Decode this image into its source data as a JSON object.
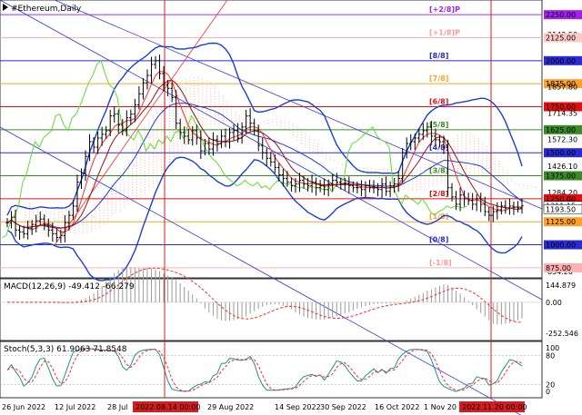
{
  "window": {
    "title": "#Ethereum,Daily"
  },
  "colors": {
    "bg": "#ffffff",
    "ohlc": "#000000",
    "bollinger": "#1a3fd6",
    "envelope": "#ff2a2a",
    "chikou": "#5fdc2f",
    "kumo": "#f0b9a8",
    "channel": "#3a3ad6",
    "macd_signal": "#ff2a2a",
    "macd_hist": "#9a9a9a",
    "stoch_main": "#1f8f8f",
    "stoch_signal": "#ff2a2a",
    "vline": "#d21e1e"
  },
  "murrey_levels": [
    {
      "label": "[+2/8]P",
      "price": 2250.0,
      "line": "#9b30ff",
      "text": "#a020f0"
    },
    {
      "label": "[+1/8]P",
      "price": 2125.0,
      "line": "#ffb0b0",
      "text": "#ff9a9a"
    },
    {
      "label": "[8/8]",
      "price": 2000.0,
      "line": "#2a2ad6",
      "text": "#2a2ad6"
    },
    {
      "label": "[7/8]",
      "price": 1875.0,
      "line": "#ffa126",
      "text": "#ffa126"
    },
    {
      "label": "[6/8]",
      "price": 1750.0,
      "line": "#e11010",
      "text": "#e11010"
    },
    {
      "label": "[5/8]",
      "price": 1625.0,
      "line": "#3a8a2a",
      "text": "#3a8a2a"
    },
    {
      "label": "[4/8]",
      "price": 1500.0,
      "line": "#2a2ad6",
      "text": "#2a2ad6"
    },
    {
      "label": "[3/8]",
      "price": 1375.0,
      "line": "#3a8a2a",
      "text": "#3a8a2a"
    },
    {
      "label": "[2/8]",
      "price": 1250.0,
      "line": "#e11010",
      "text": "#e11010"
    },
    {
      "label": "[1/8]",
      "price": 1125.0,
      "line": "#ffa126",
      "text": "#ffa126"
    },
    {
      "label": "[0/8]",
      "price": 1000.0,
      "line": "#2a2ad6",
      "text": "#2a2ad6"
    },
    {
      "label": "[-1/8]",
      "price": 875.0,
      "line": "#ffb0b0",
      "text": "#ff9a9a"
    }
  ],
  "price_axis": {
    "ticks": [
      {
        "text": "2250.00",
        "price": 2250.0,
        "box": "#a020f0"
      },
      {
        "text": "2142.50",
        "price": 2142.5
      },
      {
        "text": "2125.00",
        "price": 2125.0,
        "box": "#ffc8c8"
      },
      {
        "text": "2000.00",
        "price": 2000.0,
        "box": "#2a2ad6"
      },
      {
        "text": "1875.00",
        "price": 1875.0,
        "box": "#ffa126"
      },
      {
        "text": "1857.80",
        "price": 1857.8
      },
      {
        "text": "1750.00",
        "price": 1750.0,
        "box": "#e11010"
      },
      {
        "text": "1714.35",
        "price": 1714.35
      },
      {
        "text": "1625.00",
        "price": 1625.0,
        "box": "#3a8a2a"
      },
      {
        "text": "1572.30",
        "price": 1572.3
      },
      {
        "text": "1500.00",
        "price": 1500.0,
        "box": "#2a2ad6"
      },
      {
        "text": "1426.10",
        "price": 1426.1
      },
      {
        "text": "1375.00",
        "price": 1375.0,
        "box": "#3a8a2a"
      },
      {
        "text": "1284.20",
        "price": 1284.2
      },
      {
        "text": "1250.00",
        "price": 1250.0,
        "box": "#e11010"
      },
      {
        "text": "1211.15",
        "price": 1211.15,
        "box": "#ffffff"
      },
      {
        "text": "1193.50",
        "price": 1193.5,
        "box": "#ffffff"
      },
      {
        "text": "1125.00",
        "price": 1125.0,
        "box": "#ffa126"
      },
      {
        "text": "1000.00",
        "price": 1000.0,
        "box": "#2a2ad6"
      },
      {
        "text": "854.20",
        "price": 854.2
      },
      {
        "text": "875.00",
        "price": 875.0,
        "box": "#ffb0b0"
      }
    ]
  },
  "macd": {
    "label": "MACD(12,26,9) -49.412 -66.279",
    "ticks": [
      "144.879",
      "0.00",
      "-252.546"
    ]
  },
  "stoch": {
    "label": "Stoch(5,3,3) 61.9063 71.8548",
    "ticks": [
      "100",
      "80",
      "20",
      "0"
    ]
  },
  "time_axis": {
    "labels": [
      "26 Jun 2022",
      "12 Jul 2022",
      "28 Jul",
      "29 Aug 2022",
      "14 Sep 2022",
      "30 Sep 2022",
      "16 Oct 2022",
      "1 Nov 20"
    ],
    "highlight_labels": [
      "2022.08.14 00:00",
      "2022.11.20 00:00"
    ]
  },
  "chart_data": {
    "type": "ohlc",
    "symbol": "#Ethereum",
    "timeframe": "Daily",
    "ylim": [
      830,
      2310
    ],
    "close_series": [
      1120,
      1150,
      1080,
      1070,
      1060,
      1090,
      1110,
      1130,
      1140,
      1110,
      1080,
      1060,
      1040,
      1050,
      1120,
      1160,
      1210,
      1340,
      1390,
      1480,
      1560,
      1530,
      1580,
      1600,
      1620,
      1700,
      1710,
      1650,
      1620,
      1690,
      1710,
      1760,
      1820,
      1880,
      1920,
      1980,
      2000,
      1930,
      1870,
      1850,
      1800,
      1660,
      1610,
      1590,
      1570,
      1620,
      1580,
      1510,
      1550,
      1520,
      1570,
      1550,
      1590,
      1560,
      1610,
      1620,
      1580,
      1640,
      1700,
      1660,
      1620,
      1540,
      1500,
      1470,
      1450,
      1420,
      1380,
      1360,
      1340,
      1320,
      1330,
      1350,
      1330,
      1320,
      1340,
      1310,
      1320,
      1300,
      1330,
      1350,
      1340,
      1330,
      1330,
      1320,
      1310,
      1310,
      1300,
      1320,
      1310,
      1310,
      1300,
      1330,
      1290,
      1320,
      1330,
      1360,
      1500,
      1550,
      1560,
      1580,
      1600,
      1620,
      1640,
      1590,
      1570,
      1560,
      1530,
      1310,
      1260,
      1220,
      1270,
      1250,
      1240,
      1220,
      1250,
      1220,
      1180,
      1160,
      1180,
      1190,
      1210,
      1200,
      1210,
      1205,
      1200,
      1211
    ],
    "macd_main": -49.412,
    "macd_signal": -66.279,
    "stoch_main": 61.9063,
    "stoch_signal": 71.8548
  }
}
